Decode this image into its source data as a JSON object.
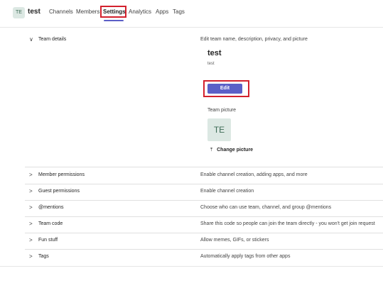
{
  "header": {
    "team_initials": "TE",
    "team_name": "test",
    "tabs": [
      {
        "label": "Channels"
      },
      {
        "label": "Members"
      },
      {
        "label": "Settings"
      },
      {
        "label": "Analytics"
      },
      {
        "label": "Apps"
      },
      {
        "label": "Tags"
      }
    ]
  },
  "team_details": {
    "title": "Team details",
    "description": "Edit team name, description, privacy, and picture",
    "team_name": "test",
    "team_description": "test",
    "edit_label": "Edit",
    "picture_label": "Team picture",
    "picture_initials": "TE",
    "change_picture_label": "Change picture"
  },
  "sections": [
    {
      "title": "Member permissions",
      "description": "Enable channel creation, adding apps, and more"
    },
    {
      "title": "Guest permissions",
      "description": "Enable channel creation"
    },
    {
      "title": "@mentions",
      "description": "Choose who can use team, channel, and group @mentions"
    },
    {
      "title": "Team code",
      "description": "Share this code so people can join the team directly - you won't get join request"
    },
    {
      "title": "Fun stuff",
      "description": "Allow memes, GIFs, or stickers"
    },
    {
      "title": "Tags",
      "description": "Automatically apply tags from other apps"
    }
  ],
  "icons": {
    "collapsed": "chevron-right-icon",
    "expanded": "chevron-down-icon",
    "upload": "upload-icon"
  },
  "colors": {
    "accent": "#5b5fc7",
    "highlight": "#d3212d",
    "avatar_bg": "#dce8e3"
  }
}
